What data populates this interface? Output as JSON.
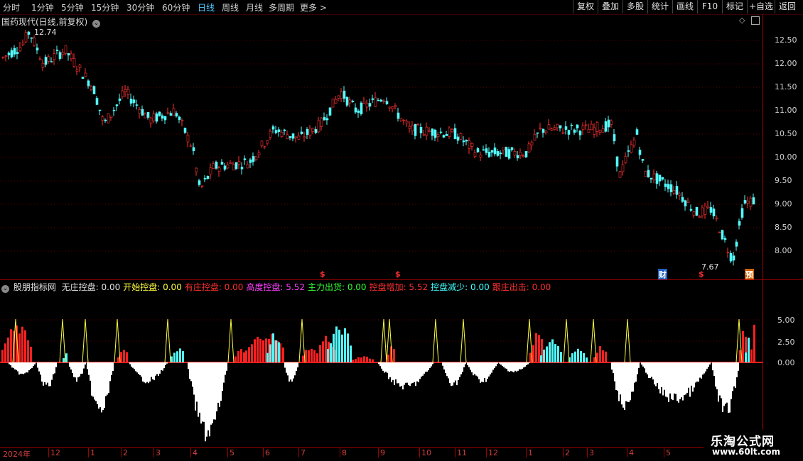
{
  "toolbar": {
    "timeframes": [
      "分时",
      "1分钟",
      "5分钟",
      "15分钟",
      "30分钟",
      "60分钟",
      "日线",
      "周线",
      "月线",
      "多周期",
      "更多 >"
    ],
    "active_timeframe": "日线",
    "buttons": [
      "复权",
      "叠加",
      "多股",
      "统计",
      "画线",
      "F10",
      "标记",
      "+自选",
      "返回"
    ]
  },
  "main": {
    "title": "国药现代(日线,前复权)",
    "high_label": "12.74",
    "low_label": "7.67",
    "y_ticks": [
      "12.50",
      "12.00",
      "11.50",
      "11.00",
      "10.50",
      "10.00",
      "9.50",
      "9.00",
      "8.50",
      "8.00"
    ],
    "markers": {
      "s1": "$",
      "s2": "$",
      "s3": "$",
      "cai": "财",
      "yu": "预"
    }
  },
  "indicator": {
    "name": "股朋指标网",
    "items": [
      {
        "label": "无庄控盘:",
        "value": "0.00",
        "color": "#e0e0e0"
      },
      {
        "label": "开始控盘:",
        "value": "0.00",
        "color": "#ffff40"
      },
      {
        "label": "有庄控盘:",
        "value": "0.00",
        "color": "#ff3030"
      },
      {
        "label": "高度控盘:",
        "value": "5.52",
        "color": "#ff40ff"
      },
      {
        "label": "主力出货:",
        "value": "0.00",
        "color": "#30ff30"
      },
      {
        "label": "控盘增加:",
        "value": "5.52",
        "color": "#ff3030"
      },
      {
        "label": "控盘减少:",
        "value": "0.00",
        "color": "#40ffff"
      },
      {
        "label": "跟庄出击:",
        "value": "0.00",
        "color": "#ff3030"
      }
    ],
    "y_ticks": [
      "5.00",
      "2.50",
      "0.00"
    ]
  },
  "xaxis": {
    "labels": [
      "2024年",
      "12",
      "1",
      "2",
      "3",
      "4",
      "5",
      "6",
      "7",
      "8",
      "9",
      "10",
      "11",
      "12",
      "1",
      "2",
      "3",
      "4",
      "5"
    ]
  },
  "watermark": {
    "line1": "乐淘公式网",
    "line2": "www.60lt.com"
  },
  "colors": {
    "up": "#ff3232",
    "down": "#54fcfc",
    "border": "#a00000"
  }
}
